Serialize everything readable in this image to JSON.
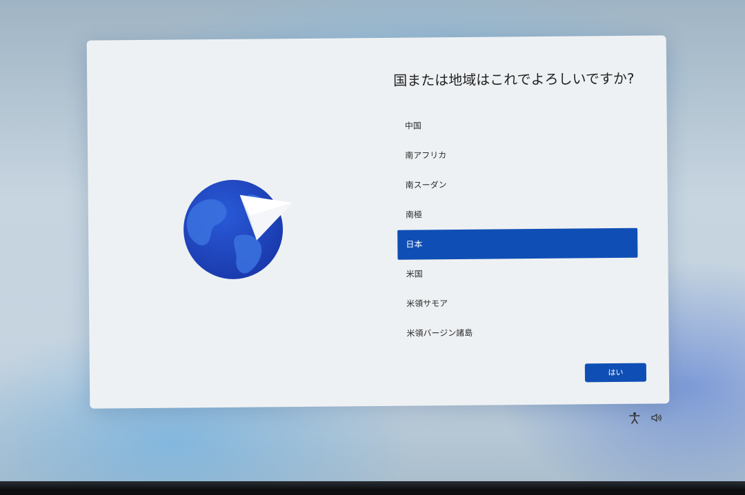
{
  "dialog": {
    "title": "国または地域はこれでよろしいですか?",
    "items": [
      {
        "label": "中国",
        "selected": false
      },
      {
        "label": "南アフリカ",
        "selected": false
      },
      {
        "label": "南スーダン",
        "selected": false
      },
      {
        "label": "南極",
        "selected": false
      },
      {
        "label": "日本",
        "selected": true
      },
      {
        "label": "米国",
        "selected": false
      },
      {
        "label": "米領サモア",
        "selected": false
      },
      {
        "label": "米領バージン諸島",
        "selected": false
      }
    ],
    "yes_label": "はい"
  },
  "illustration": {
    "icon": "globe-with-paper-plane-icon"
  },
  "tray": {
    "accessibility_icon": "accessibility-icon",
    "volume_icon": "volume-icon"
  },
  "colors": {
    "accent": "#0f4fb5",
    "globe": "#1f48c4"
  }
}
